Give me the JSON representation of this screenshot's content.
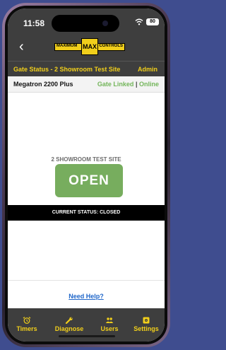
{
  "status_bar": {
    "time": "11:58",
    "battery": "80"
  },
  "logo": {
    "left": "MAXIMUM",
    "center": "MAX",
    "right": "CONTROLS"
  },
  "header": {
    "gate_title": "Gate Status - 2 Showroom Test Site",
    "admin_label": "Admin"
  },
  "device": {
    "name": "Megatron 2200 Plus",
    "linked": "Gate Linked",
    "separator": "|",
    "online": "Online"
  },
  "main": {
    "site_name": "2 SHOWROOM TEST SITE",
    "open_label": "OPEN",
    "current_status": "CURRENT STATUS: CLOSED",
    "help_link": "Need Help?"
  },
  "tabs": [
    {
      "label": "Timers",
      "icon": "alarm-clock-icon"
    },
    {
      "label": "Diagnose",
      "icon": "wrench-icon"
    },
    {
      "label": "Users",
      "icon": "users-icon"
    },
    {
      "label": "Settings",
      "icon": "settings-icon"
    }
  ],
  "colors": {
    "accent": "#f1cf1b",
    "open_button": "#77ad5e",
    "link": "#1f66c9",
    "header_bg": "#3e3e3e"
  }
}
